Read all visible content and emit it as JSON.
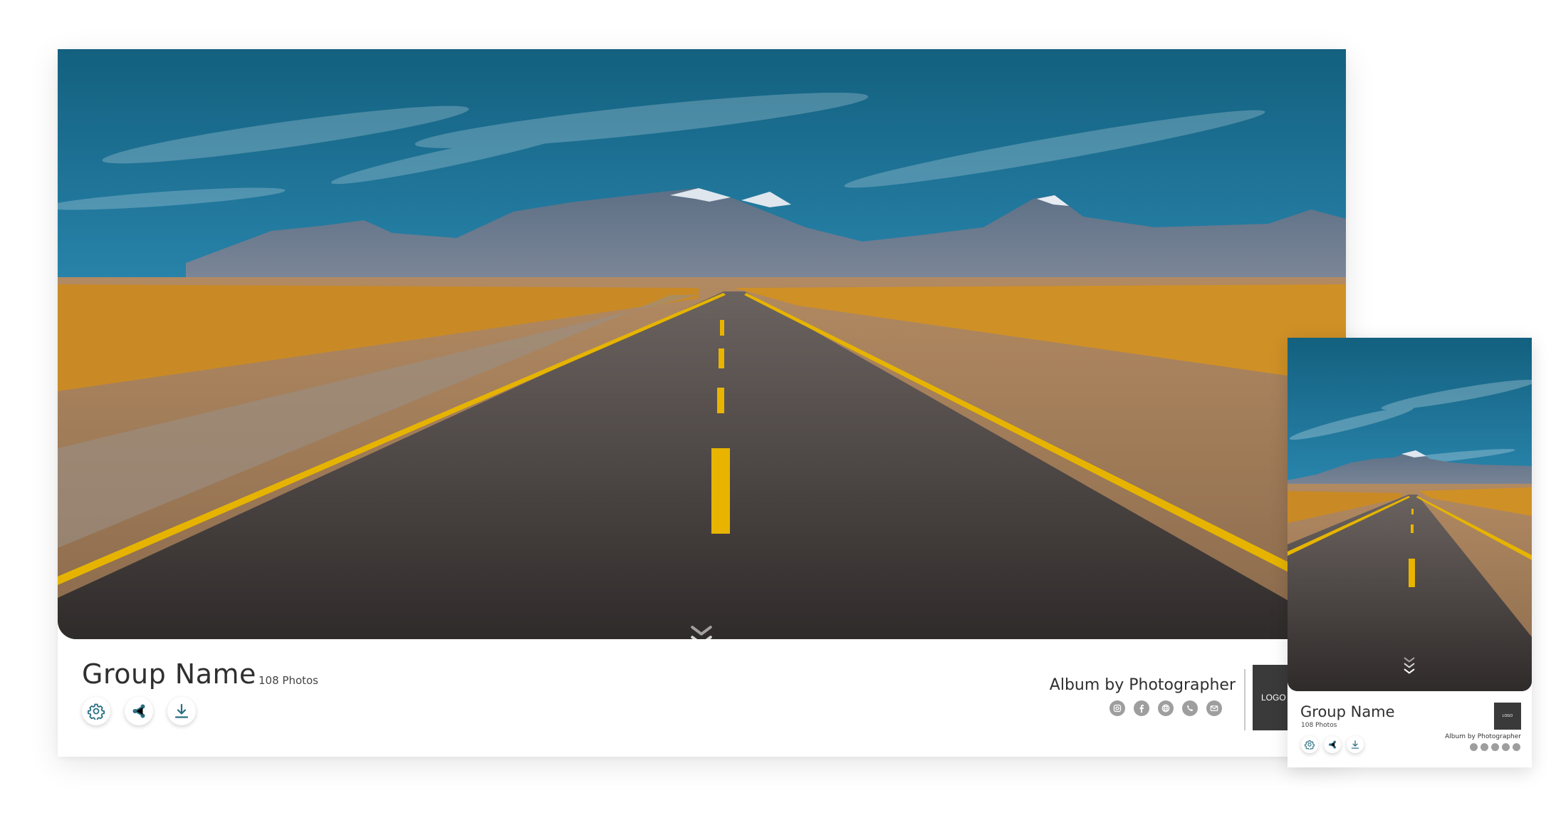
{
  "colors": {
    "accent": "#2a6f82",
    "social_gray": "#9e9e9e",
    "logo_bg": "#3a3a3a",
    "title": "#2f2f2f"
  },
  "desktop": {
    "cover_image": "desert-road-mountains",
    "scroll_indicator_icon": "triple-chevron-down-icon",
    "group_name": "Group Name",
    "photo_count": "108 Photos",
    "actions": [
      {
        "name": "settings",
        "icon": "gear-icon"
      },
      {
        "name": "share",
        "icon": "share-icon"
      },
      {
        "name": "download",
        "icon": "download-icon"
      }
    ],
    "album_by": "Album by Photographer",
    "social_icons": [
      "instagram-icon",
      "facebook-icon",
      "website-icon",
      "phone-icon",
      "email-icon"
    ],
    "logo_text": "LOGO"
  },
  "mobile": {
    "cover_image": "desert-road-mountains",
    "scroll_indicator_icon": "triple-chevron-down-icon",
    "group_name": "Group Name",
    "photo_count": "108 Photos",
    "actions": [
      {
        "name": "settings",
        "icon": "gear-icon"
      },
      {
        "name": "share",
        "icon": "share-icon"
      },
      {
        "name": "download",
        "icon": "download-icon"
      }
    ],
    "album_by": "Album by Photographer",
    "social_icons": [
      "instagram-icon",
      "facebook-icon",
      "website-icon",
      "phone-icon",
      "email-icon"
    ],
    "logo_text": "LOGO"
  }
}
